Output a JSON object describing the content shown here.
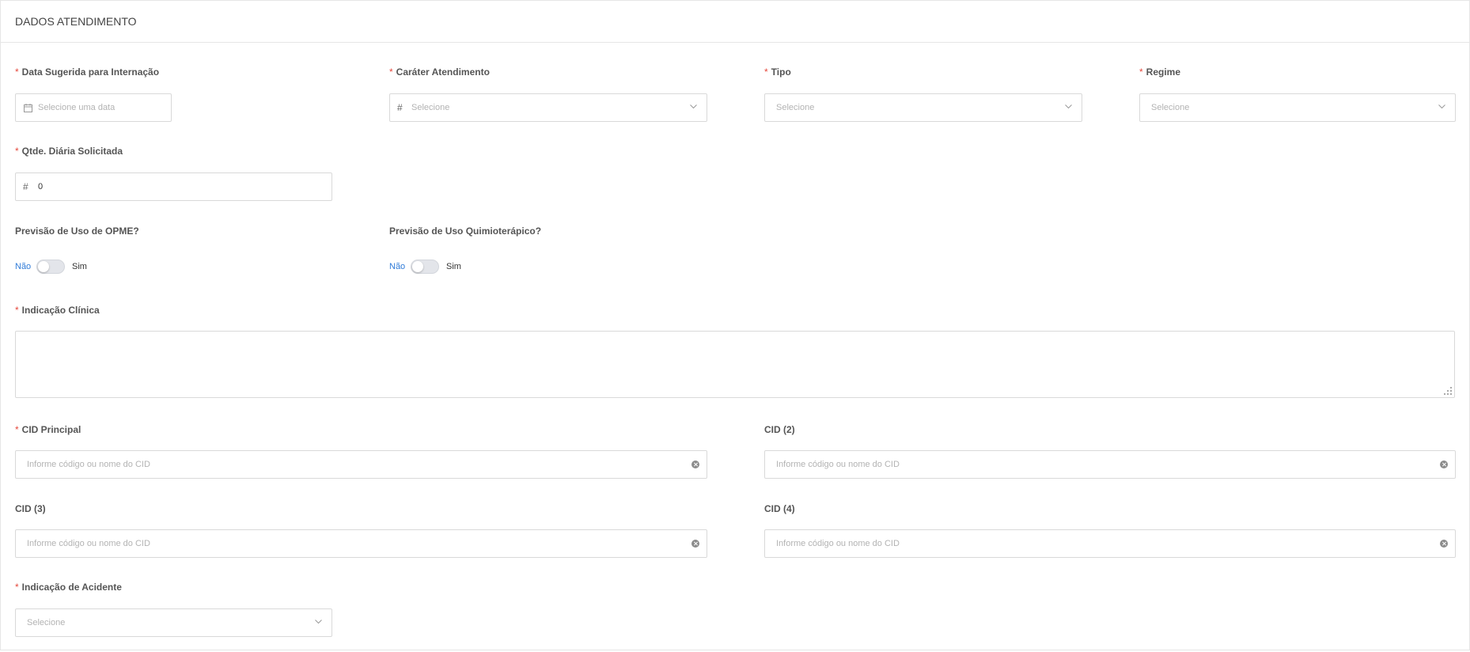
{
  "section": {
    "title": "DADOS ATENDIMENTO"
  },
  "required_mark": "*",
  "fields": {
    "data_sugerida": {
      "label": "Data Sugerida para Internação",
      "placeholder": "Selecione uma data",
      "icon": "calendar-icon"
    },
    "carater": {
      "label": "Caráter Atendimento",
      "placeholder": "Selecione",
      "icon": "hash-icon"
    },
    "tipo": {
      "label": "Tipo",
      "placeholder": "Selecione"
    },
    "regime": {
      "label": "Regime",
      "placeholder": "Selecione"
    },
    "qtde_diaria": {
      "label": "Qtde. Diária Solicitada",
      "value": "0",
      "icon": "hash-icon"
    },
    "opme": {
      "label": "Previsão de Uso de OPME?",
      "off_label": "Não",
      "on_label": "Sim",
      "checked": false
    },
    "quimio": {
      "label": "Previsão de Uso Quimioterápico?",
      "off_label": "Não",
      "on_label": "Sim",
      "checked": false
    },
    "indicacao_clinica": {
      "label": "Indicação Clínica",
      "value": ""
    },
    "cid_principal": {
      "label": "CID Principal",
      "placeholder": "Informe código ou nome do CID"
    },
    "cid2": {
      "label": "CID (2)",
      "placeholder": "Informe código ou nome do CID"
    },
    "cid3": {
      "label": "CID (3)",
      "placeholder": "Informe código ou nome do CID"
    },
    "cid4": {
      "label": "CID (4)",
      "placeholder": "Informe código ou nome do CID"
    },
    "indicacao_acidente": {
      "label": "Indicação de Acidente",
      "placeholder": "Selecione"
    }
  },
  "colors": {
    "required": "#e5483c",
    "toggle_active_label": "#2f7bd8",
    "border": "#d9d9d9"
  },
  "icon_glyphs": {
    "hash": "#"
  }
}
